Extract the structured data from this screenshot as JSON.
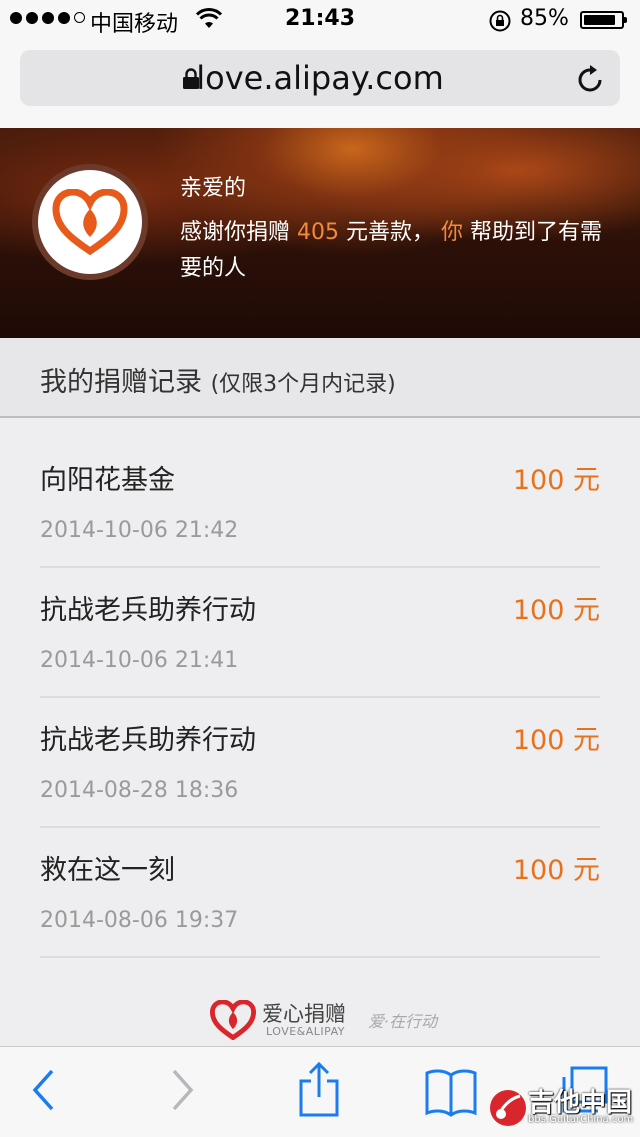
{
  "status_bar": {
    "carrier": "中国移动",
    "time": "21:43",
    "battery_percent": "85%",
    "battery_level": 0.85,
    "signal_bars": 4,
    "signal_max": 5
  },
  "browser": {
    "url": "love.alipay.com"
  },
  "hero": {
    "greeting": "亲爱的",
    "msg_prefix": "感谢你捐赠",
    "amount": "405",
    "msg_middle": "元善款，",
    "you": "你",
    "msg_suffix": "帮助到了有需要的人"
  },
  "records_header": {
    "title": "我的捐赠记录",
    "note": "(仅限3个月内记录)"
  },
  "records": [
    {
      "name": "向阳花基金",
      "amount": "100 元",
      "date": "2014-10-06 21:42"
    },
    {
      "name": "抗战老兵助养行动",
      "amount": "100 元",
      "date": "2014-10-06 21:41"
    },
    {
      "name": "抗战老兵助养行动",
      "amount": "100 元",
      "date": "2014-08-28 18:36"
    },
    {
      "name": "救在这一刻",
      "amount": "100 元",
      "date": "2014-08-06 19:37"
    }
  ],
  "footer": {
    "brand_cn": "爱心捐赠",
    "brand_en": "LOVE&ALIPAY",
    "slogan": "爱·在行动"
  },
  "watermark": {
    "title": "吉他中国",
    "url": "bbs.GuitarChina.com"
  },
  "icons": {
    "back": "chevron-left-icon",
    "forward": "chevron-right-icon",
    "share": "share-icon",
    "bookmarks": "book-icon",
    "tabs": "tabs-icon"
  },
  "colors": {
    "accent_orange": "#e8711c",
    "ios_blue": "#1a7cf0"
  }
}
